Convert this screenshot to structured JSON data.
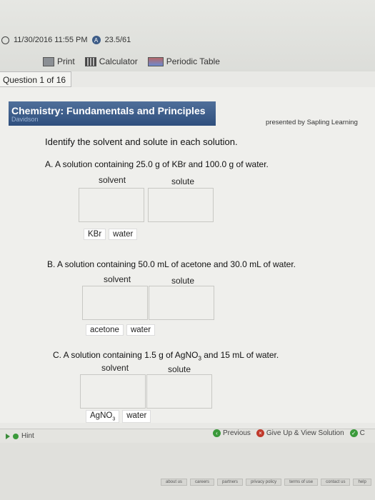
{
  "status": {
    "datetime": "11/30/2016 11:55 PM",
    "score": "23.5/61"
  },
  "toolbar": {
    "print": "Print",
    "calculator": "Calculator",
    "periodic_table": "Periodic Table"
  },
  "question_tab": "Question 1 of 16",
  "header": {
    "course_title": "Chemistry: Fundamentals and Principles",
    "instructor": "Davidson",
    "presented_by": "presented by Sapling Learning"
  },
  "question": "Identify the solvent and solute in each solution.",
  "columns": {
    "solvent": "solvent",
    "solute": "solute"
  },
  "parts": [
    {
      "title": "A. A solution containing 25.0 g of KBr and 100.0 g of water.",
      "chips": [
        "KBr",
        "water"
      ]
    },
    {
      "title": "B. A solution containing 50.0 mL of acetone and 30.0 mL of water.",
      "chips": [
        "acetone",
        "water"
      ]
    },
    {
      "title_pre": "C. A solution containing 1.5 g of AgNO",
      "title_sub": "3",
      "title_post": " and 15 mL of water.",
      "chip_pre": "AgNO",
      "chip_sub": "3",
      "chips": [
        "water"
      ]
    }
  ],
  "footer": {
    "hint": "Hint",
    "previous": "Previous",
    "give_up": "Give Up & View Solution",
    "check": "C"
  },
  "links": [
    "about us",
    "careers",
    "partners",
    "privacy policy",
    "terms of use",
    "contact us",
    "help"
  ]
}
